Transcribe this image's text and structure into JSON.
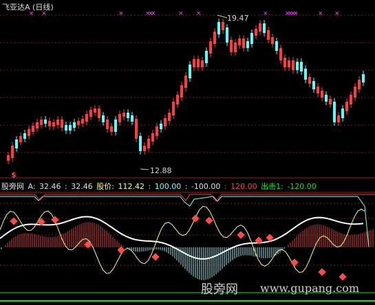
{
  "header": {
    "title": "飞亚达A (日线)"
  },
  "price_annotations": {
    "high": "19.47",
    "low": "12.88"
  },
  "indicator": {
    "name": "股旁网",
    "a_label": "A:",
    "a_value1": "32.46",
    "sep": ":",
    "a_value2": "32.46",
    "price_label": "股价:",
    "price_value": "112.42",
    "v1": "100.00",
    "v2": "-100.00",
    "v3": "120.00",
    "chuji_label": "出击1:",
    "chuji_value": "-120.00",
    "signal_marker": "$"
  },
  "watermark": {
    "cn": "股旁网",
    "url": "www.gupang.com"
  },
  "colors": {
    "up": "#ff3b3b",
    "down": "#54ffff",
    "grid": "#8b1a1a",
    "white_line": "#ffffff",
    "yellow_line": "#ffff80",
    "cyan_line": "#7fffff",
    "magenta_mark": "#ff40ff",
    "green_line": "#22dd22"
  }
}
